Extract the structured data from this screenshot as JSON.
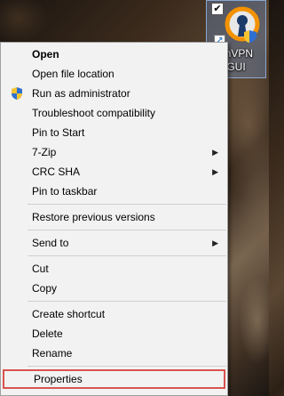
{
  "desktop_icon": {
    "label_line1": "enVPN",
    "label_line2": "GUI",
    "checkbox": "✔",
    "shortcut_arrow": "↗"
  },
  "menu": {
    "items": [
      {
        "label": "Open",
        "bold": true
      },
      {
        "label": "Open file location"
      },
      {
        "label": "Run as administrator",
        "icon": "uac-shield-icon"
      },
      {
        "label": "Troubleshoot compatibility"
      },
      {
        "label": "Pin to Start"
      },
      {
        "label": "7-Zip",
        "submenu": true
      },
      {
        "label": "CRC SHA",
        "submenu": true
      },
      {
        "label": "Pin to taskbar"
      },
      {
        "label": "Restore previous versions"
      },
      {
        "label": "Send to",
        "submenu": true
      },
      {
        "label": "Cut"
      },
      {
        "label": "Copy"
      },
      {
        "label": "Create shortcut"
      },
      {
        "label": "Delete"
      },
      {
        "label": "Rename"
      },
      {
        "label": "Properties",
        "highlighted": true
      }
    ],
    "submenu_arrow": "›"
  },
  "colors": {
    "highlight_border": "#d9534f",
    "menu_background": "#f2f2f2"
  }
}
